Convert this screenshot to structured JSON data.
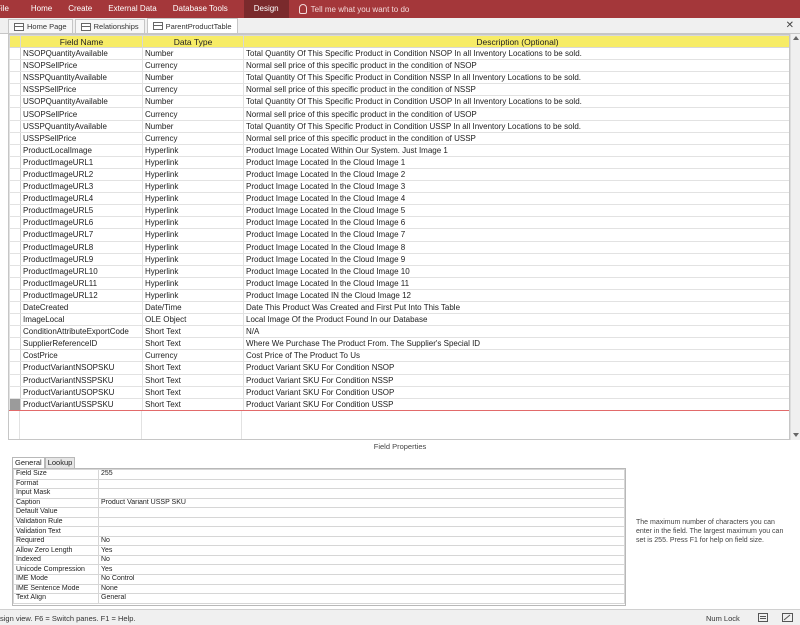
{
  "ribbon": {
    "tabs": [
      "File",
      "Home",
      "Create",
      "External Data",
      "Database Tools",
      "Design"
    ],
    "tell_me": "Tell me what you want to do"
  },
  "doc_tabs": [
    "Home Page",
    "Relationships",
    "ParentProductTable"
  ],
  "grid": {
    "headers": [
      "Field Name",
      "Data Type",
      "Description (Optional)"
    ],
    "rows": [
      [
        "NSOPQuantityAvailable",
        "Number",
        "Total Quantity Of This Specific Product in Condition NSOP In all Inventory Locations to be sold."
      ],
      [
        "NSOPSellPrice",
        "Currency",
        "Normal sell price of this specific product in the condition of NSOP"
      ],
      [
        "NSSPQuantityAvailable",
        "Number",
        "Total Quantity Of This Specific Product in Condition NSSP In all Inventory Locations to be sold."
      ],
      [
        "NSSPSellPrice",
        "Currency",
        "Normal sell price of this specific product in the condition of NSSP"
      ],
      [
        "USOPQuantityAvailable",
        "Number",
        "Total Quantity Of This Specific Product in Condition USOP In all Inventory Locations to be sold."
      ],
      [
        "USOPSellPrice",
        "Currency",
        "Normal sell price of this specific product in the condition of USOP"
      ],
      [
        "USSPQuantityAvailable",
        "Number",
        "Total Quantity Of This Specific Product in Condition USSP In all Inventory Locations to be sold."
      ],
      [
        "USSPSellPrice",
        "Currency",
        "Normal sell price of this specific product in the condition of USSP"
      ],
      [
        "ProductLocalImage",
        "Hyperlink",
        "Product Image Located Within Our System. Just Image 1"
      ],
      [
        "ProductImageURL1",
        "Hyperlink",
        "Product Image Located In the Cloud Image 1"
      ],
      [
        "ProductImageURL2",
        "Hyperlink",
        "Product Image Located In the Cloud Image 2"
      ],
      [
        "ProductImageURL3",
        "Hyperlink",
        "Product Image Located In the Cloud Image 3"
      ],
      [
        "ProductImageURL4",
        "Hyperlink",
        "Product Image Located In the Cloud Image 4"
      ],
      [
        "ProductImageURL5",
        "Hyperlink",
        "Product Image Located In the Cloud Image 5"
      ],
      [
        "ProductImageURL6",
        "Hyperlink",
        "Product Image Located In the Cloud Image 6"
      ],
      [
        "ProductImageURL7",
        "Hyperlink",
        "Product Image Located In the Cloud Image 7"
      ],
      [
        "ProductImageURL8",
        "Hyperlink",
        "Product Image Located In the Cloud Image 8"
      ],
      [
        "ProductImageURL9",
        "Hyperlink",
        "Product Image Located In the Cloud Image 9"
      ],
      [
        "ProductImageURL10",
        "Hyperlink",
        "Product Image Located In the Cloud Image 10"
      ],
      [
        "ProductImageURL11",
        "Hyperlink",
        "Product Image Located In the Cloud Image 11"
      ],
      [
        "ProductImageURL12",
        "Hyperlink",
        "Product Image Located IN the Cloud Image 12"
      ],
      [
        "DateCreated",
        "Date/Time",
        "Date This Product Was Created and First Put Into This Table"
      ],
      [
        "ImageLocal",
        "OLE Object",
        "Local Image Of the Product Found In our Database"
      ],
      [
        "ConditionAttributeExportCode",
        "Short Text",
        "N/A"
      ],
      [
        "SupplierReferenceID",
        "Short Text",
        "Where We Purchase The Product From. The Supplier's Special ID"
      ],
      [
        "CostPrice",
        "Currency",
        "Cost Price of The Product To Us"
      ],
      [
        "ProductVariantNSOPSKU",
        "Short Text",
        "Product Variant SKU For Condition NSOP"
      ],
      [
        "ProductVariantNSSPSKU",
        "Short Text",
        "Product Variant SKU For Condition NSSP"
      ],
      [
        "ProductVariantUSOPSKU",
        "Short Text",
        "Product Variant SKU For Condition USOP"
      ],
      [
        "ProductVariantUSSPSKU",
        "Short Text",
        "Product Variant SKU For Condition USSP"
      ]
    ],
    "current_row_index": 29
  },
  "field_properties": {
    "title": "Field Properties",
    "tabs": [
      "General",
      "Lookup"
    ],
    "rows": [
      [
        "Field Size",
        "255"
      ],
      [
        "Format",
        ""
      ],
      [
        "Input Mask",
        ""
      ],
      [
        "Caption",
        "Product Variant USSP SKU"
      ],
      [
        "Default Value",
        ""
      ],
      [
        "Validation Rule",
        ""
      ],
      [
        "Validation Text",
        ""
      ],
      [
        "Required",
        "No"
      ],
      [
        "Allow Zero Length",
        "Yes"
      ],
      [
        "Indexed",
        "No"
      ],
      [
        "Unicode Compression",
        "Yes"
      ],
      [
        "IME Mode",
        "No Control"
      ],
      [
        "IME Sentence Mode",
        "None"
      ],
      [
        "Text Align",
        "General"
      ]
    ],
    "help": "The maximum number of characters you can enter in the field. The largest maximum you can set is 255. Press F1 for help on field size."
  },
  "status": {
    "message": "sign view.  F6 = Switch panes.  F1 = Help.",
    "num_lock": "Num Lock"
  }
}
